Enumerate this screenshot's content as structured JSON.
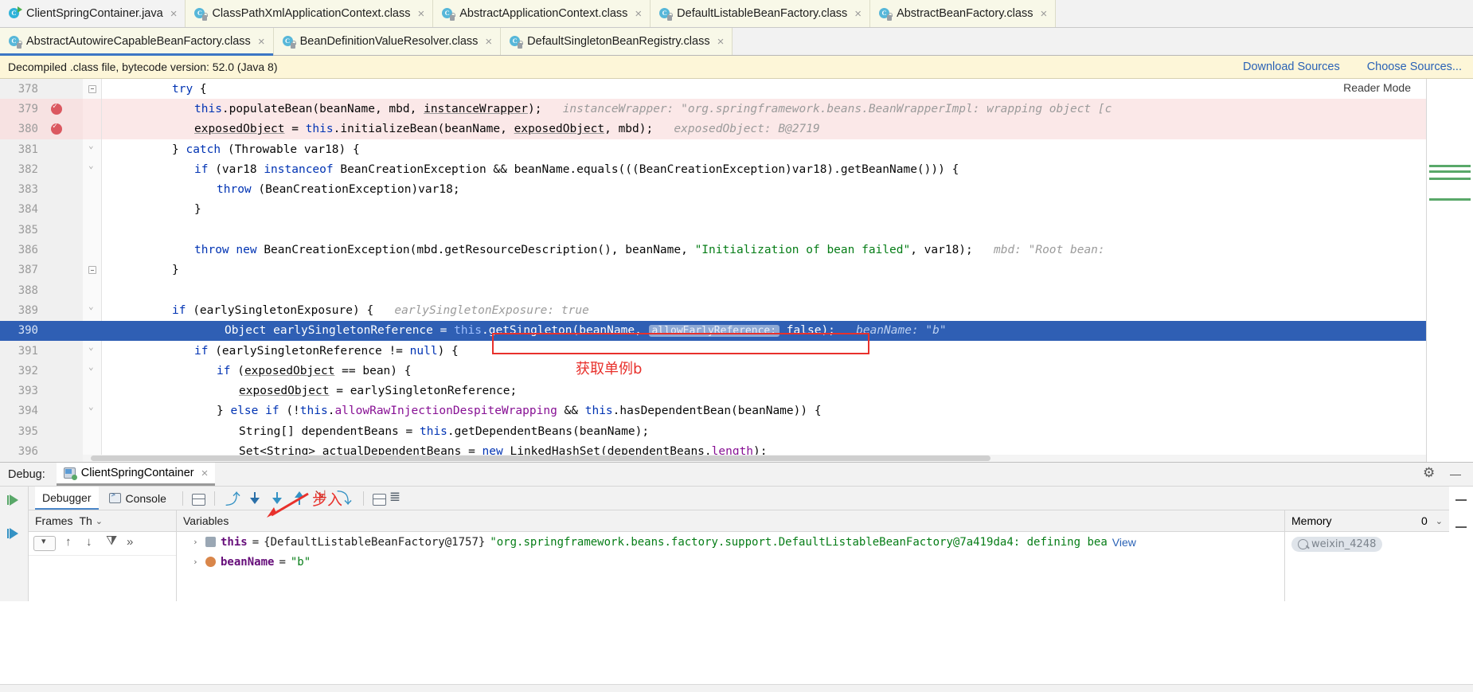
{
  "editor_tabs_row1": [
    {
      "label": "ClientSpringContainer.java",
      "icon": "java-class-icon",
      "kind": "java",
      "selected": false
    },
    {
      "label": "ClassPathXmlApplicationContext.class",
      "icon": "compiled-class-icon",
      "kind": "class",
      "selected": false
    },
    {
      "label": "AbstractApplicationContext.class",
      "icon": "compiled-class-icon",
      "kind": "class",
      "selected": false
    },
    {
      "label": "DefaultListableBeanFactory.class",
      "icon": "compiled-class-icon",
      "kind": "class",
      "selected": false
    },
    {
      "label": "AbstractBeanFactory.class",
      "icon": "compiled-class-icon",
      "kind": "class",
      "selected": false
    }
  ],
  "editor_tabs_row2": [
    {
      "label": "AbstractAutowireCapableBeanFactory.class",
      "icon": "compiled-class-icon",
      "kind": "class",
      "selected": true
    },
    {
      "label": "BeanDefinitionValueResolver.class",
      "icon": "compiled-class-icon",
      "kind": "class",
      "selected": false
    },
    {
      "label": "DefaultSingletonBeanRegistry.class",
      "icon": "compiled-class-icon",
      "kind": "class",
      "selected": false
    }
  ],
  "close_glyph": "×",
  "notice": {
    "message": "Decompiled .class file, bytecode version: 52.0 (Java 8)",
    "download_sources": "Download Sources",
    "choose_sources": "Choose Sources..."
  },
  "editor": {
    "reader_mode": "Reader Mode",
    "first_line": 378,
    "annotation_box_text": "getSingleton(beanName, allowEarlyReference: false);",
    "annotation_comment_cn": "获取单例b",
    "lines": [
      {
        "n": 378,
        "bp": false,
        "fold": "minus",
        "exec": false
      },
      {
        "n": 379,
        "bp": true,
        "fold": null,
        "exec": false
      },
      {
        "n": 380,
        "bp": true,
        "fold": null,
        "exec": false
      },
      {
        "n": 381,
        "bp": false,
        "fold": "brace",
        "exec": false
      },
      {
        "n": 382,
        "bp": false,
        "fold": "brace",
        "exec": false
      },
      {
        "n": 383,
        "bp": false,
        "fold": null,
        "exec": false
      },
      {
        "n": 384,
        "bp": false,
        "fold": null,
        "exec": false
      },
      {
        "n": 385,
        "bp": false,
        "fold": null,
        "exec": false
      },
      {
        "n": 386,
        "bp": false,
        "fold": null,
        "exec": false
      },
      {
        "n": 387,
        "bp": false,
        "fold": "minus",
        "exec": false
      },
      {
        "n": 388,
        "bp": false,
        "fold": null,
        "exec": false
      },
      {
        "n": 389,
        "bp": false,
        "fold": "brace",
        "exec": false
      },
      {
        "n": 390,
        "bp": true,
        "fold": null,
        "exec": true,
        "bulb": true
      },
      {
        "n": 391,
        "bp": false,
        "fold": "brace",
        "exec": false
      },
      {
        "n": 392,
        "bp": false,
        "fold": "brace",
        "exec": false
      },
      {
        "n": 393,
        "bp": false,
        "fold": null,
        "exec": false
      },
      {
        "n": 394,
        "bp": false,
        "fold": "brace",
        "exec": false
      },
      {
        "n": 395,
        "bp": false,
        "fold": null,
        "exec": false
      },
      {
        "n": 396,
        "bp": false,
        "fold": null,
        "exec": false
      }
    ],
    "code": {
      "l378": {
        "ind": 12,
        "kw": "try",
        "rest": " {"
      },
      "l379": {
        "ind": 16,
        "text": "this.populateBean(beanName, mbd, instanceWrapper);",
        "hint": "instanceWrapper: \"org.springframework.beans.BeanWrapperImpl: wrapping object [c"
      },
      "l380": {
        "ind": 16,
        "text": "exposedObject = this.initializeBean(beanName, exposedObject, mbd);",
        "hint": "exposedObject: B@2719"
      },
      "l381": {
        "ind": 12,
        "text": "} catch (Throwable var18) {"
      },
      "l382": {
        "ind": 16,
        "text": "if (var18 instanceof BeanCreationException && beanName.equals(((BeanCreationException)var18).getBeanName())) {"
      },
      "l383": {
        "ind": 20,
        "text": "throw (BeanCreationException)var18;"
      },
      "l384": {
        "ind": 16,
        "text": "}"
      },
      "l385": {
        "ind": 0,
        "text": ""
      },
      "l386": {
        "ind": 16,
        "text": "throw new BeanCreationException(mbd.getResourceDescription(), beanName, \"Initialization of bean failed\", var18);",
        "hint": "mbd: \"Root bean:"
      },
      "l387": {
        "ind": 12,
        "text": "}"
      },
      "l388": {
        "ind": 0,
        "text": ""
      },
      "l389": {
        "ind": 12,
        "text": "if (earlySingletonExposure) {",
        "hint": "earlySingletonExposure: true"
      },
      "l390": {
        "ind": 16,
        "text": "Object earlySingletonReference = this.getSingleton(beanName, allowEarlyReference: false);",
        "hint": "beanName: \"b\""
      },
      "l391": {
        "ind": 16,
        "text": "if (earlySingletonReference != null) {"
      },
      "l392": {
        "ind": 20,
        "text": "if (exposedObject == bean) {"
      },
      "l393": {
        "ind": 24,
        "text": "exposedObject = earlySingletonReference;"
      },
      "l394": {
        "ind": 20,
        "text": "} else if (!this.allowRawInjectionDespiteWrapping && this.hasDependentBean(beanName)) {"
      },
      "l395": {
        "ind": 24,
        "text": "String[] dependentBeans = this.getDependentBeans(beanName);"
      },
      "l396": {
        "ind": 24,
        "text": "Set<String> actualDependentBeans = new LinkedHashSet(dependentBeans.length);"
      }
    }
  },
  "debug": {
    "header_label": "Debug:",
    "session_name": "ClientSpringContainer",
    "annotation_cn": "步入",
    "tabs": [
      {
        "label": "Debugger",
        "icon": "debugger-icon",
        "selected": true
      },
      {
        "label": "Console",
        "icon": "console-icon",
        "selected": false
      }
    ],
    "toolbar_icons": [
      "show-execution-point-icon",
      "step-over-icon",
      "step-into-icon",
      "force-step-into-icon",
      "step-out-icon",
      "drop-frame-icon",
      "run-to-cursor-icon",
      "evaluate-expression-icon",
      "settings-icon"
    ],
    "frames": {
      "title": "Frames",
      "thread_label": "Th",
      "chevron": "⌄"
    },
    "variables": {
      "title": "Variables",
      "rows": [
        {
          "expander": "›",
          "name": "this",
          "equals": "=",
          "type": "{DefaultListableBeanFactory@1757}",
          "value": "\"org.springframework.beans.factory.support.DefaultListableBeanFactory@7a419da4: defining bea",
          "link": "View",
          "icon": "object-field-icon"
        },
        {
          "expander": "›",
          "name": "beanName",
          "equals": "=",
          "type": "",
          "value": "\"b\"",
          "link": "",
          "icon": "param-field-icon"
        }
      ]
    },
    "memory": {
      "title": "Memory",
      "count": "0",
      "chevron": "⌄",
      "watermark": "weixin_4248"
    }
  }
}
